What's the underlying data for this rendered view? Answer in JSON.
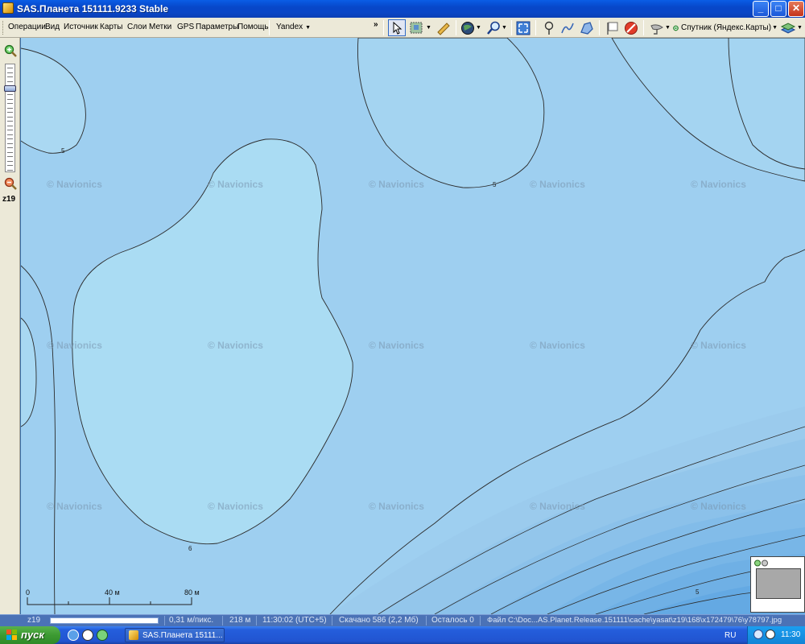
{
  "window": {
    "title": "SAS.Планета 151111.9233 Stable",
    "controls": {
      "minimize": "_",
      "maximize": "□",
      "close": "✕"
    }
  },
  "menu": {
    "items": [
      "Операции",
      "Вид",
      "Источник",
      "Карты",
      "Слои",
      "Метки",
      "GPS",
      "Параметры",
      "Помощь"
    ],
    "source_dropdown": "Yandex",
    "overflow": "»"
  },
  "toolbar": {
    "map_type_label": "Спутник (Яндекс.Карты)",
    "icons": [
      "cursor-icon",
      "select-area-icon",
      "ruler-icon",
      "globe-icon",
      "search-icon",
      "fullscreen-icon",
      "placemark-icon",
      "path-icon",
      "polygon-icon",
      "label-icon",
      "no-entry-icon",
      "satellite-dish-icon",
      "map-source-icon",
      "layers-icon"
    ]
  },
  "zoom": {
    "level": "z19",
    "plus": "+",
    "minus": "−"
  },
  "map": {
    "watermark": "© Navionics",
    "contour_labels": [
      "5",
      "5",
      "6",
      "5"
    ],
    "scale": {
      "labels": [
        "0",
        "40 м",
        "80 м"
      ]
    }
  },
  "status": {
    "zoom": "z19",
    "resolution": "0,31 м/пикс.",
    "distance": "218 м",
    "time": "11:30:02 (UTC+5)",
    "downloaded": "Скачано 586 (2,2 Мб)",
    "remaining": "Осталось 0",
    "file": "Файл C:\\Doc...AS.Planet.Release.151111\\cache\\yasat\\z19\\168\\x172479\\76\\y78797.jpg"
  },
  "taskbar": {
    "start": "пуск",
    "task": "SAS.Планета 15111...",
    "lang": "RU",
    "clock": "11:30"
  },
  "colors": {
    "water_deep": "#9ecff0",
    "water_shallow": "#aadcf3",
    "contour": "#2b2b2b",
    "deep_band": "#6cc3ec"
  }
}
